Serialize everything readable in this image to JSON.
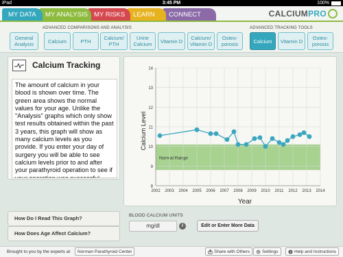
{
  "status_bar": {
    "device": "iPad",
    "time": "3:45 PM",
    "battery": "100%"
  },
  "nav": {
    "tabs": [
      {
        "label": "MY DATA",
        "color": "#35a7bd"
      },
      {
        "label": "MY ANALYSIS",
        "color": "#8dbb3e",
        "active": true
      },
      {
        "label": "MY RISKS",
        "color": "#d6484f"
      },
      {
        "label": "LEARN",
        "color": "#e6b21f"
      },
      {
        "label": "CONNECT",
        "color": "#8b6aa7"
      }
    ],
    "logo_text": "CALCIUM",
    "logo_accent": "PRO"
  },
  "toolbar": {
    "advanced_label": "ADVANCED COMPARISONS AND ANALYSIS",
    "tracking_label": "ADVANCED TRACKING TOOLS",
    "buttons": [
      "General Analysis",
      "Calcium",
      "PTH",
      "Calcium/ PTH",
      "Urine Calcium",
      "Vitamin D",
      "Calcium/ Vitamin D",
      "Osteo- porosis"
    ],
    "tracking_buttons": [
      "Calcium",
      "Vitamin D",
      "Osteo- porosis"
    ],
    "active_tracking": "Calcium"
  },
  "panel": {
    "title": "Calcium Tracking",
    "description": "The amount of calcium in your blood is shown over time. The green area shows the normal values for your age. Unlike the \"Analysis\" graphs which only show test results obtained within the past 3 years, this graph will show as many calcium levels as you provide. If you enter your day of surgery you will be able to see calcium levels prior to and after your parathyroid operation to see if your operation was successful."
  },
  "side_buttons": [
    "How Do I Read This Graph?",
    "How Does Age Affect Calcium?"
  ],
  "chart_data": {
    "type": "line",
    "ylabel": "Calcium Level",
    "xlabel": "Year",
    "ylim": [
      8,
      14
    ],
    "xlim": [
      2002,
      2014
    ],
    "yticks": [
      8,
      9,
      10,
      11,
      12,
      13,
      14
    ],
    "xticks": [
      2002,
      2003,
      2004,
      2005,
      2006,
      2007,
      2008,
      2009,
      2010,
      2011,
      2012,
      2013,
      2014
    ],
    "normal_range": {
      "label": "Normal Range",
      "min": 8.8,
      "max": 10.1,
      "color": "#a7d290"
    },
    "line_color": "#3aa6bf",
    "series": [
      {
        "points": [
          [
            2002.3,
            10.55
          ],
          [
            2005.0,
            10.85
          ],
          [
            2006.0,
            10.65
          ],
          [
            2006.4,
            10.65
          ],
          [
            2007.2,
            10.35
          ],
          [
            2007.7,
            10.75
          ],
          [
            2008.0,
            10.1
          ],
          [
            2008.6,
            10.1
          ],
          [
            2009.2,
            10.4
          ],
          [
            2009.6,
            10.45
          ],
          [
            2010.0,
            10.0
          ],
          [
            2010.5,
            10.4
          ],
          [
            2011.0,
            10.2
          ],
          [
            2011.3,
            10.1
          ],
          [
            2011.6,
            10.3
          ],
          [
            2012.0,
            10.5
          ],
          [
            2012.5,
            10.6
          ],
          [
            2012.8,
            10.7
          ],
          [
            2013.2,
            10.5
          ]
        ]
      }
    ],
    "grid": true
  },
  "units": {
    "label": "BLOOD CALCIUM UNITS",
    "value": "mg/dl",
    "edit_label": "Edit or Enter More Data"
  },
  "footer": {
    "credit": "Brought to you by the experts at",
    "credit_link": "Norman Parathyroid Center",
    "share": "Share with Others",
    "settings": "Settings",
    "help": "Help and Instructions"
  }
}
